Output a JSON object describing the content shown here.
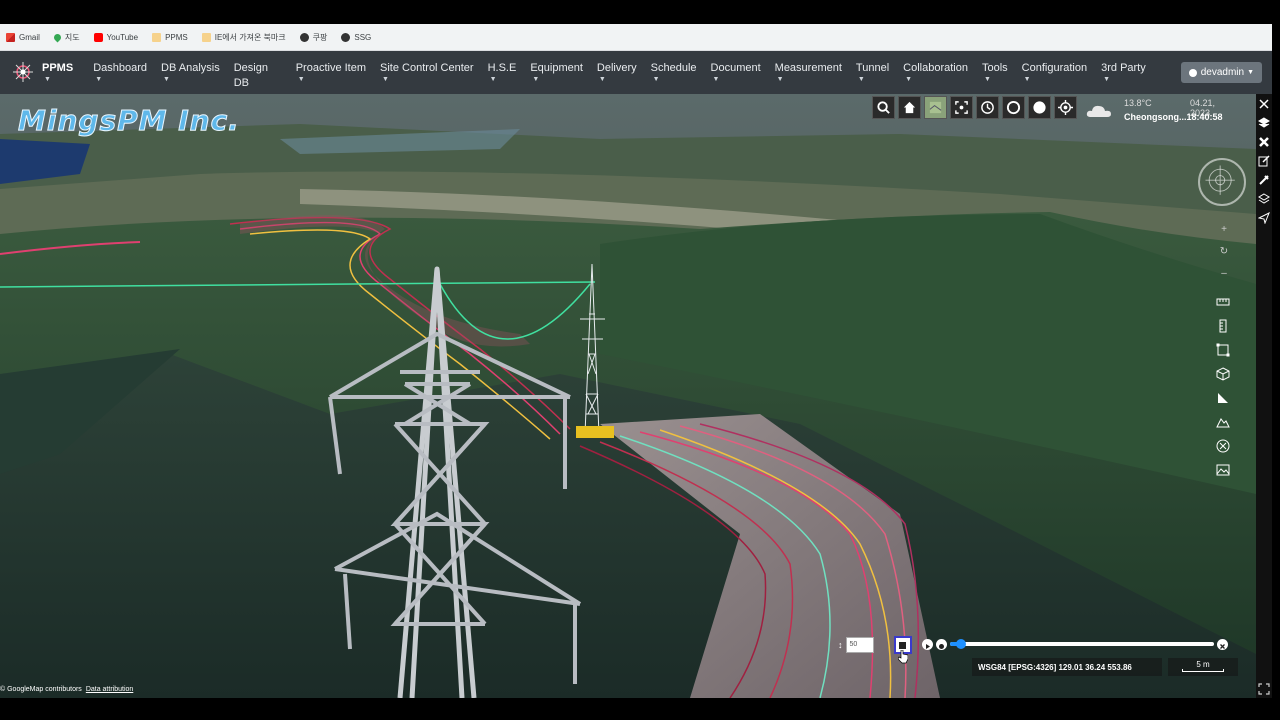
{
  "bookmarks": [
    {
      "label": "Gmail",
      "icon": "gmail-icon"
    },
    {
      "label": "지도",
      "icon": "map-pin-icon"
    },
    {
      "label": "YouTube",
      "icon": "youtube-icon"
    },
    {
      "label": "PPMS",
      "icon": "folder-icon"
    },
    {
      "label": "IE에서 가져온 북마크",
      "icon": "folder-icon"
    },
    {
      "label": "쿠팡",
      "icon": "globe-icon"
    },
    {
      "label": "SSG",
      "icon": "globe-icon"
    }
  ],
  "navbar": {
    "brand": "PPMS",
    "items": [
      {
        "label": "Dashboard"
      },
      {
        "label": "DB Analysis"
      },
      {
        "label": "Design DB"
      },
      {
        "label": "Proactive Item"
      },
      {
        "label": "Site Control Center"
      },
      {
        "label": "H.S.E"
      },
      {
        "label": "Equipment"
      },
      {
        "label": "Delivery"
      },
      {
        "label": "Schedule"
      },
      {
        "label": "Document"
      },
      {
        "label": "Measurement"
      },
      {
        "label": "Tunnel"
      },
      {
        "label": "Collaboration"
      },
      {
        "label": "Tools"
      },
      {
        "label": "Configuration"
      },
      {
        "label": "3rd Party"
      }
    ],
    "user": "devadmin"
  },
  "scene": {
    "brand_title": "MingsPM Inc.",
    "weather": {
      "temp": "13.8°C",
      "date": "04.21, 2023",
      "place": "Cheongsong...18:40:58"
    },
    "toolbar": [
      "search-icon",
      "home-icon",
      "map-layer-icon",
      "focus-icon",
      "history-icon",
      "circle-icon",
      "sphere-icon",
      "locate-icon"
    ],
    "right_tools": [
      "ruler-icon",
      "measure-vertical-icon",
      "area-icon",
      "cube-icon",
      "angle-icon",
      "profile-icon",
      "clear-icon",
      "terrain-icon"
    ],
    "height_value": "50",
    "timeline_progress": 0.04,
    "coordinates": "WSG84 [EPSG:4326] 129.01 36.24 553.86",
    "scale": "5 m",
    "attribution": "© GoogleMap contributors",
    "attribution_link": "Data attribution"
  }
}
